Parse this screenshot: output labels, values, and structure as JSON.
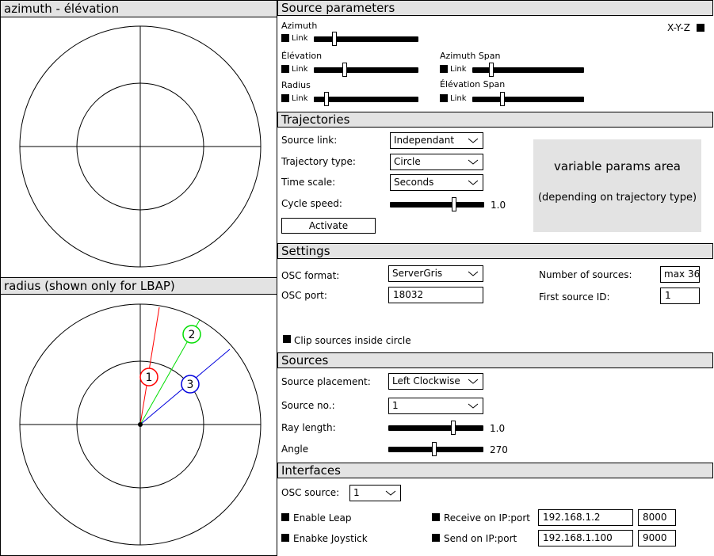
{
  "panels": {
    "azimuth_title": "azimuth - élévation",
    "radius_title": "radius (shown only for LBAP)"
  },
  "source_markers": [
    {
      "label": "1",
      "color": "#ff0000"
    },
    {
      "label": "2",
      "color": "#00cc00"
    },
    {
      "label": "3",
      "color": "#0000dd"
    }
  ],
  "source_params": {
    "title": "Source parameters",
    "azimuth": "Azimuth",
    "elevation": "Élévation",
    "radius": "Radius",
    "azimuth_span": "Azimuth Span",
    "elevation_span": "Élévation Span",
    "link": "Link",
    "xyz": "X-Y-Z"
  },
  "trajectories": {
    "title": "Trajectories",
    "source_link_label": "Source link:",
    "source_link_value": "Independant",
    "trajectory_type_label": "Trajectory type:",
    "trajectory_type_value": "Circle",
    "time_scale_label": "Time scale:",
    "time_scale_value": "Seconds",
    "cycle_speed_label": "Cycle speed:",
    "cycle_speed_value": "1.0",
    "activate": "Activate",
    "variable_params": "variable params area",
    "variable_params_note": "(depending on trajectory type)"
  },
  "settings": {
    "title": "Settings",
    "osc_format_label": "OSC format:",
    "osc_format_value": "ServerGris",
    "osc_port_label": "OSC port:",
    "osc_port_value": "18032",
    "num_sources_label": "Number of sources:",
    "num_sources_value": "max 36",
    "first_source_label": "First source ID:",
    "first_source_value": "1",
    "clip_label": "Clip sources inside circle"
  },
  "sources": {
    "title": "Sources",
    "placement_label": "Source placement:",
    "placement_value": "Left Clockwise",
    "source_no_label": "Source no.:",
    "source_no_value": "1",
    "ray_length_label": "Ray length:",
    "ray_length_value": "1.0",
    "angle_label": "Angle",
    "angle_value": "270"
  },
  "interfaces": {
    "title": "Interfaces",
    "osc_source_label": "OSC source:",
    "osc_source_value": "1",
    "enable_leap": "Enable Leap",
    "enable_joystick": "Enabke Joystick",
    "receive_label": "Receive on IP:port",
    "receive_ip": "192.168.1.2",
    "receive_port": "8000",
    "send_label": "Send on IP:port",
    "send_ip": "192.168.1.100",
    "send_port": "9000"
  }
}
